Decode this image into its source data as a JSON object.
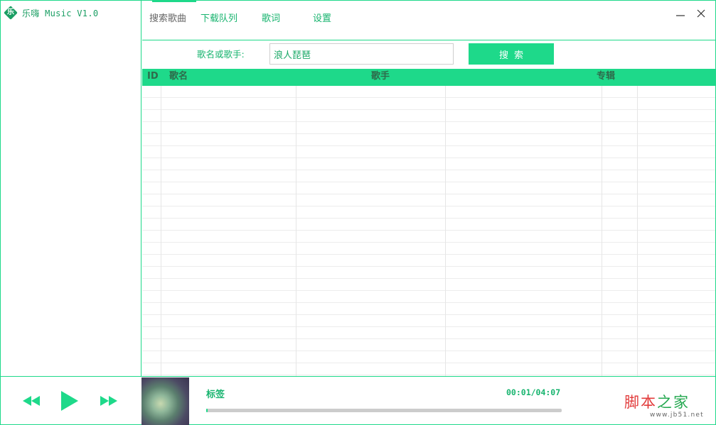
{
  "app": {
    "logo_glyph": "乐",
    "title": "乐嗨 Music V1.0"
  },
  "tabs": [
    {
      "label": "搜索歌曲",
      "active": true
    },
    {
      "label": "下载队列",
      "active": false
    },
    {
      "label": "歌词",
      "active": false
    },
    {
      "label": "设置",
      "active": false
    }
  ],
  "search": {
    "label": "歌名或歌手:",
    "value": "浪人琵琶",
    "button": "搜索"
  },
  "table": {
    "columns": [
      "ID",
      "歌名",
      "歌手",
      "专辑"
    ],
    "rows": []
  },
  "player": {
    "track_label": "标签",
    "time": "00:01/04:07",
    "progress": 0.004
  },
  "watermark": {
    "text_a": "脚本",
    "text_b": "之家",
    "url": "www.jb51.net"
  },
  "colors": {
    "accent": "#1ed98a",
    "accent_text": "#18b46f",
    "header_text": "#2e6b4b"
  },
  "icons": {
    "prev": "fast-rewind-icon",
    "play": "play-icon",
    "next": "fast-forward-icon",
    "minimize": "minimize-icon",
    "close": "close-icon"
  }
}
